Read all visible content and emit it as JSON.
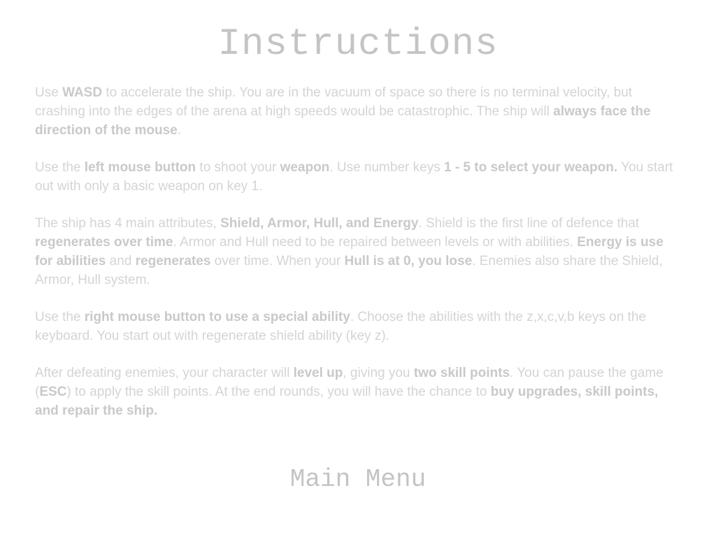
{
  "screen": {
    "title": "Instructions",
    "main_menu_label": "Main Menu"
  },
  "paragraphs": [
    [
      {
        "t": "Use ",
        "b": false
      },
      {
        "t": "WASD",
        "b": true
      },
      {
        "t": " to accelerate the ship.  You are in the vacuum of space so there is no terminal velocity, but crashing into the edges of the arena at high speeds would be catastrophic.  The ship will ",
        "b": false
      },
      {
        "t": "always face the direction of the mouse",
        "b": true
      },
      {
        "t": ".",
        "b": false
      }
    ],
    [
      {
        "t": "Use the ",
        "b": false
      },
      {
        "t": "left mouse button",
        "b": true
      },
      {
        "t": " to shoot your ",
        "b": false
      },
      {
        "t": "weapon",
        "b": true
      },
      {
        "t": ".  Use number keys ",
        "b": false
      },
      {
        "t": "1 - 5 to select your weapon.",
        "b": true
      },
      {
        "t": " You start out with only a basic weapon on key 1.",
        "b": false
      }
    ],
    [
      {
        "t": "The ship has 4 main attributes, ",
        "b": false
      },
      {
        "t": "Shield, Armor, Hull, and Energy",
        "b": true
      },
      {
        "t": ".  Shield is the first line of defence that ",
        "b": false
      },
      {
        "t": "regenerates over time",
        "b": true
      },
      {
        "t": ".  Armor and Hull need to be repaired between levels or with abilities. ",
        "b": false
      },
      {
        "t": "Energy is use for abilities",
        "b": true
      },
      {
        "t": " and ",
        "b": false
      },
      {
        "t": "regenerates",
        "b": true
      },
      {
        "t": " over time.  When your ",
        "b": false
      },
      {
        "t": "Hull is at 0, you lose",
        "b": true
      },
      {
        "t": ".  Enemies also share the Shield, Armor, Hull system.",
        "b": false
      }
    ],
    [
      {
        "t": "Use the ",
        "b": false
      },
      {
        "t": "right mouse button to use a special ability",
        "b": true
      },
      {
        "t": ".  Choose the abilities with the z,x,c,v,b keys on the keyboard.  You start out with regenerate shield ability (key z).",
        "b": false
      }
    ],
    [
      {
        "t": "After defeating enemies, your character will ",
        "b": false
      },
      {
        "t": "level up",
        "b": true
      },
      {
        "t": ", giving you ",
        "b": false
      },
      {
        "t": "two skill points",
        "b": true
      },
      {
        "t": ".  You can pause the game (",
        "b": false
      },
      {
        "t": "ESC",
        "b": true
      },
      {
        "t": ") to apply the skill points.  At the end rounds, you will have the chance to ",
        "b": false
      },
      {
        "t": "buy upgrades, skill points, and repair the ship.",
        "b": true
      }
    ]
  ]
}
